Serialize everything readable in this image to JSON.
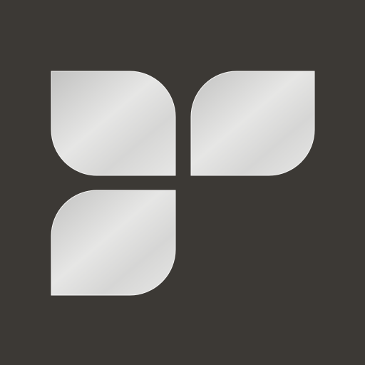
{
  "icon": {
    "name": "three-leaf-logo-icon",
    "background_color": "#3c3935",
    "leaf_colors": {
      "light": "#e6e6e5",
      "mid": "#d6d6d5",
      "shadow": "#c2c2c1",
      "edge": "#f4f4f3"
    }
  }
}
